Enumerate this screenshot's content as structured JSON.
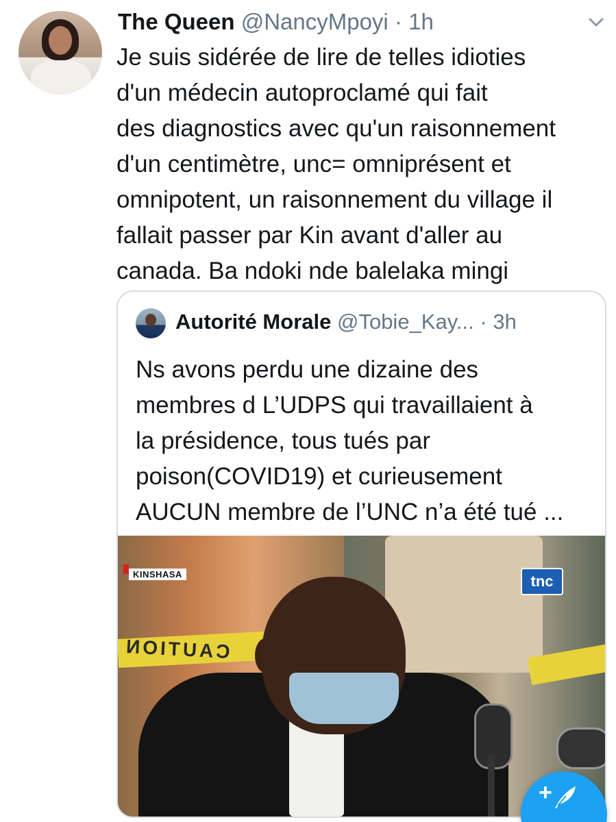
{
  "tweet": {
    "name": "The Queen",
    "handle": "@NancyMpoyi",
    "dot": "·",
    "time": "1h",
    "text": "Je suis sidérée de lire de telles idioties\nd'un médecin autoproclamé  qui fait\ndes diagnostics avec qu'un raisonnement\nd'un centimètre, unc= omniprésent et\nomnipotent, un raisonnement du village il\nfallait passer par Kin avant d'aller au\ncanada. Ba ndoki nde balelaka mingi"
  },
  "quote": {
    "name": "Autorité Morale",
    "handle": "@Tobie_Kay...",
    "dot": "·",
    "time": "3h",
    "text": "Ns avons perdu une dizaine des\nmembres d L’UDPS qui travaillaient à\nla présidence, tous tués par\npoison(COVID19) et curieusement\nAUCUN membre de l’UNC n’a été tué ...",
    "media": {
      "location_label": "KINSHASA",
      "channel_logo": "tnc",
      "tape_text": "CAUTION"
    }
  },
  "icons": {
    "caret": "chevron-down-icon",
    "compose": "compose-tweet-icon"
  },
  "colors": {
    "accent": "#1da1f2",
    "secondary_text": "#657786",
    "border": "#d7dde2"
  }
}
